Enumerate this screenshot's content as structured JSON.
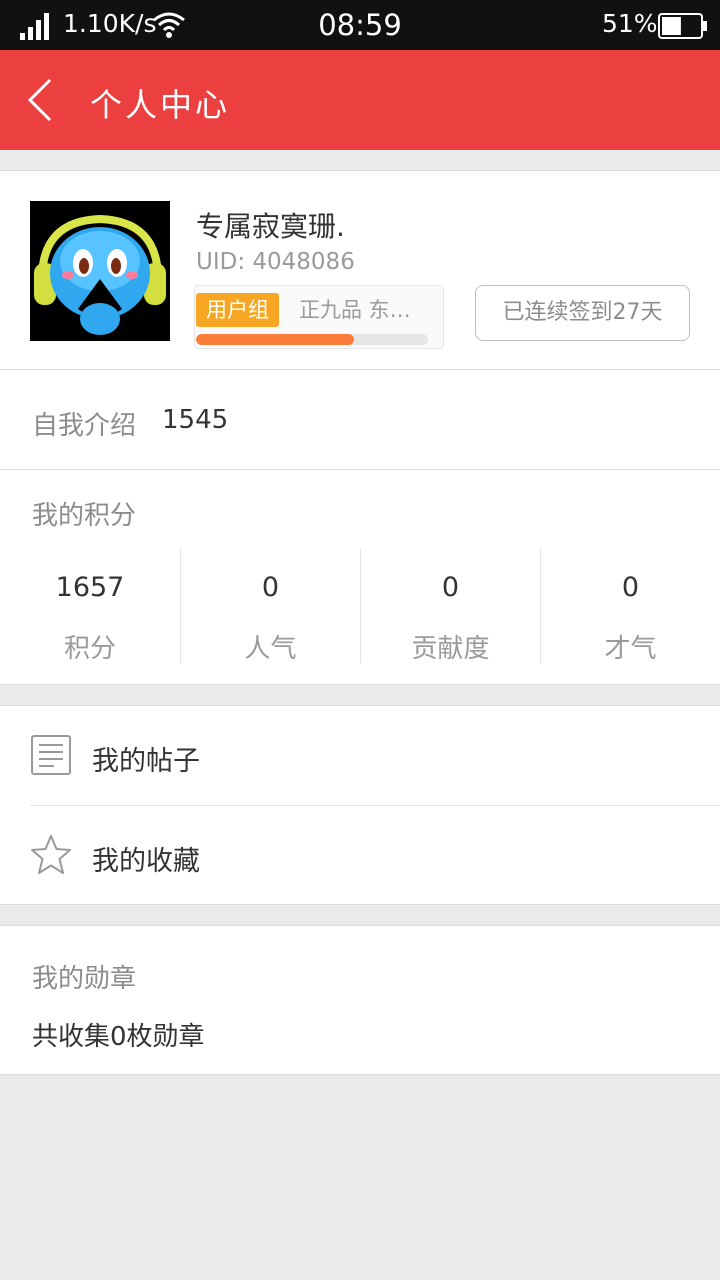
{
  "status_bar": {
    "network_speed": "1.10K/s",
    "time": "08:59",
    "battery_percent": "51%",
    "battery_level": 0.51
  },
  "app_bar": {
    "title": "个人中心"
  },
  "profile": {
    "username": "专属寂寞珊.",
    "uid": "UID: 4048086",
    "group_tag": "用户组",
    "group_name": "正九品 东…",
    "level_progress": 0.68,
    "signin_label": "已连续签到27天"
  },
  "intro": {
    "label": "自我介绍",
    "value": "1545"
  },
  "points": {
    "title": "我的积分",
    "stats": [
      {
        "value": "1657",
        "label": "积分"
      },
      {
        "value": "0",
        "label": "人气"
      },
      {
        "value": "0",
        "label": "贡献度"
      },
      {
        "value": "0",
        "label": "才气"
      }
    ]
  },
  "menu": {
    "items": [
      {
        "label": "我的帖子",
        "icon": "document-icon"
      },
      {
        "label": "我的收藏",
        "icon": "star-icon"
      }
    ]
  },
  "medals": {
    "title": "我的勋章",
    "summary": "共收集0枚勋章"
  },
  "colors": {
    "accent_red": "#ec4040",
    "tag_orange": "#f6a623",
    "progress_orange": "#fa7d3a"
  }
}
